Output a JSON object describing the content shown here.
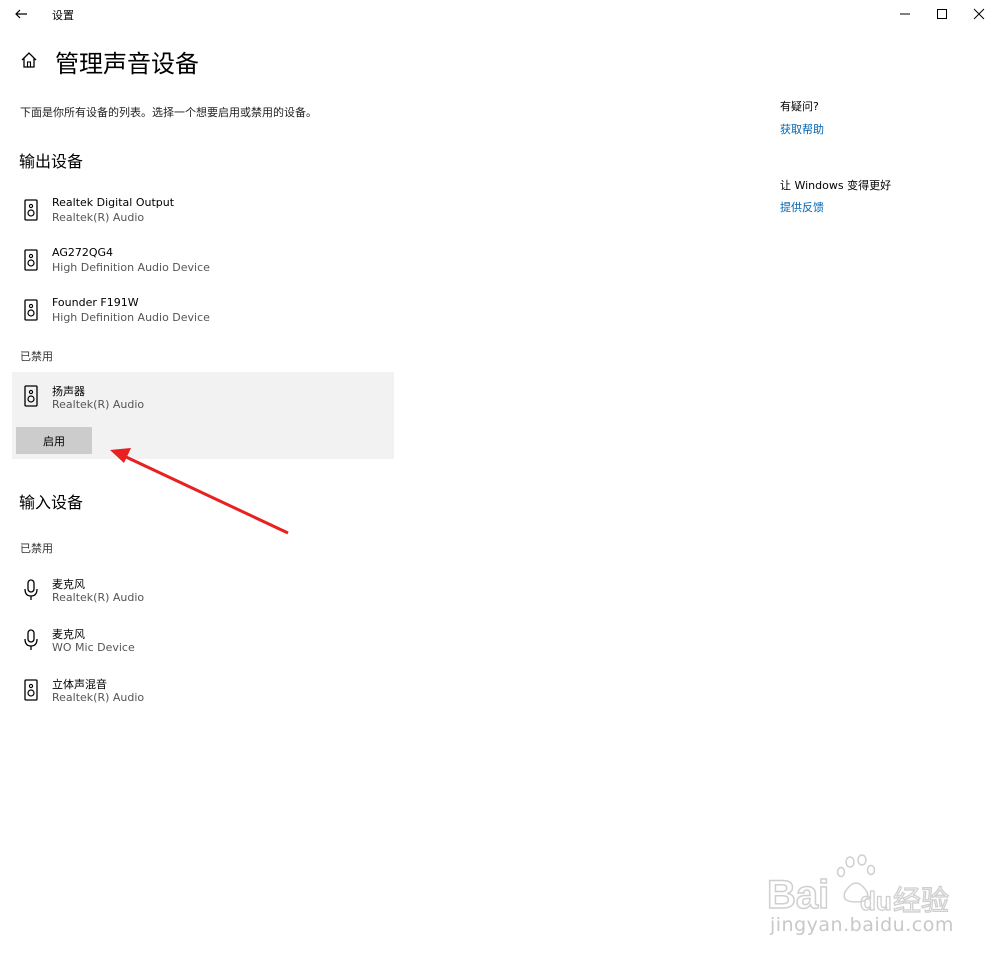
{
  "window": {
    "title": "设置",
    "back_icon": "arrow-left-icon"
  },
  "page": {
    "title": "管理声音设备",
    "intro": "下面是你所有设备的列表。选择一个想要启用或禁用的设备。"
  },
  "output": {
    "heading": "输出设备",
    "devices": [
      {
        "name": "Realtek Digital Output",
        "sub": "Realtek(R) Audio",
        "icon": "speaker-icon"
      },
      {
        "name": "AG272QG4",
        "sub": "High Definition Audio Device",
        "icon": "speaker-icon"
      },
      {
        "name": "Founder F191W",
        "sub": "High Definition Audio Device",
        "icon": "speaker-icon"
      }
    ],
    "disabled_label": "已禁用",
    "disabled_device": {
      "name": "扬声器",
      "sub": "Realtek(R) Audio",
      "icon": "speaker-icon",
      "button": "启用"
    }
  },
  "input": {
    "heading": "输入设备",
    "disabled_label": "已禁用",
    "devices": [
      {
        "name": "麦克风",
        "sub": "Realtek(R) Audio",
        "icon": "microphone-icon"
      },
      {
        "name": "麦克风",
        "sub": "WO Mic Device",
        "icon": "microphone-icon"
      },
      {
        "name": "立体声混音",
        "sub": "Realtek(R) Audio",
        "icon": "speaker-icon"
      }
    ]
  },
  "sidebar": {
    "question": "有疑问?",
    "help_link": "获取帮助",
    "improve": "让 Windows 变得更好",
    "feedback_link": "提供反馈"
  },
  "watermark": {
    "text": "jingyan.baidu.com"
  },
  "colors": {
    "link": "#0063b1",
    "selected_bg": "#f2f2f2",
    "button_bg": "#cccccc",
    "arrow": "#e8201f"
  }
}
